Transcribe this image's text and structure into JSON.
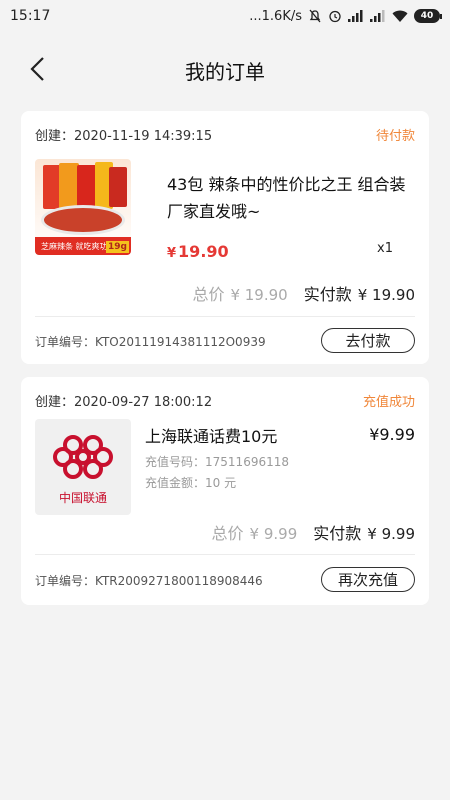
{
  "status_bar": {
    "time": "15:17",
    "network_speed": "...1.6K/s",
    "battery": "40"
  },
  "header": {
    "title": "我的订单"
  },
  "orders": [
    {
      "created_label": "创建：",
      "created": "2020-11-19 14:39:15",
      "status": "待付款",
      "product_name": "43包 辣条中的性价比之王 组合装厂家直发哦~",
      "price_symbol": "¥",
      "price": "19.90",
      "quantity": "x1",
      "total_label": "总价",
      "total_value": "¥ 19.90",
      "paid_label": "实付款",
      "paid_value": "¥ 19.90",
      "order_no_label": "订单编号：",
      "order_no": "KTO20111914381112O0939",
      "action": "去付款",
      "image": {
        "strip_text": "芝麻辣条 就吃爽功",
        "badge": "19g"
      }
    },
    {
      "created_label": "创建：",
      "created": "2020-09-27 18:00:12",
      "status": "充值成功",
      "product_name": "上海联通话费10元",
      "price": "¥9.99",
      "phone_label": "充值号码：",
      "phone": "17511696118",
      "amount_label": "充值金额：",
      "amount": "10 元",
      "total_label": "总价",
      "total_value": "¥ 9.99",
      "paid_label": "实付款",
      "paid_value": "¥ 9.99",
      "order_no_label": "订单编号：",
      "order_no": "KTR2009271800118908446",
      "action": "再次充值",
      "image": {
        "brand": "中国联通"
      }
    }
  ],
  "colors": {
    "accent_orange": "#f0873a",
    "price_red": "#e53935",
    "unicom_red": "#c8102e",
    "background": "#f3f3f3"
  }
}
